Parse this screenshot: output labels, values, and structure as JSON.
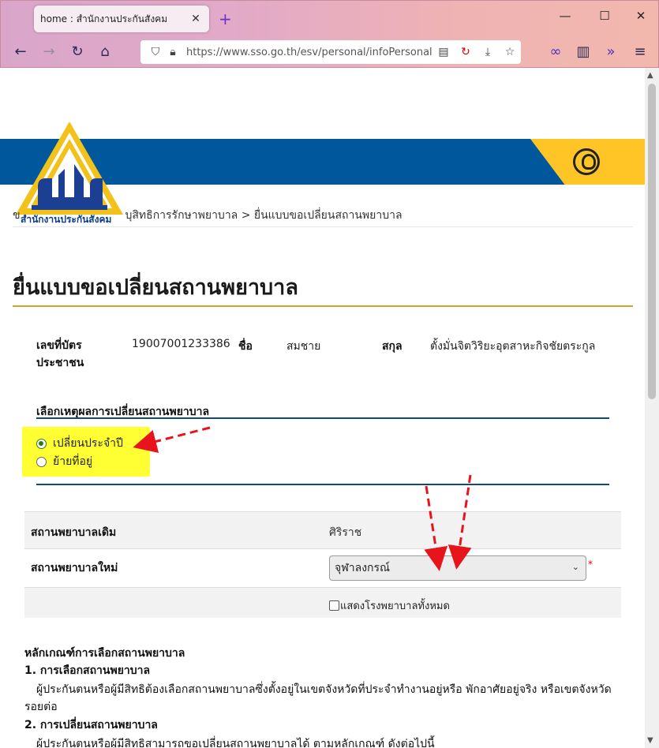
{
  "browser": {
    "tab_title": "home : สำนักงานประกันสังคม",
    "tab_close": "✕",
    "new_tab": "+",
    "url": "https://www.sso.go.th/esv/personal/infoPersonal0",
    "window_controls": [
      "—",
      "☐",
      "✕"
    ]
  },
  "header": {
    "logo_text": "สำนักงานประกันสังคม",
    "brand_blue": "#00579c",
    "brand_yellow": "#ffc425"
  },
  "breadcrumb": {
    "prefix": "ข",
    "text": "บุสิทธิการรักษาพยาบาล > ยื่นแบบขอเปลี่ยนสถานพยาบาล"
  },
  "page": {
    "title": "ยื่นแบบขอเปลี่ยนสถานพยาบาล"
  },
  "person": {
    "id_label_line1": "เลขที่บัตร",
    "id_label_line2": "ประชาชน",
    "id_value": "19007001233386",
    "name_label": "ชื่อ",
    "name_value": "สมชาย",
    "surname_label": "สกุล",
    "surname_value": "ตั้งมั่นจิตวิริยะอุตสาหะกิจชัยตระกูล"
  },
  "reason": {
    "title": "เลือกเหตุผลการเปลี่ยนสถานพยาบาล",
    "options": [
      {
        "label": "เปลี่ยนประจำปี",
        "selected": true
      },
      {
        "label": "ย้ายที่อยู่",
        "selected": false
      }
    ]
  },
  "hospital": {
    "old_label": "สถานพยาบาลเดิม",
    "old_value": "ศิริราช",
    "new_label": "สถานพยาบาลใหม่",
    "new_value": "จุฬาลงกรณ์",
    "required_mark": "*",
    "show_all_label": "แสดงโรงพยาบาลทั้งหมด"
  },
  "criteria": {
    "heading": "หลักเกณฑ์การเลือกสถานพยาบาล",
    "s1_title": "1.  การเลือกสถานพยาบาล",
    "s1_text_line1": "ผู้ประกันตนหรือผู้มีสิทธิต้องเลือกสถานพยาบาลซึ่งตั้งอยู่ในเขตจังหวัดที่ประจำทำงานอยู่หรือ พักอาศัยอยู่จริง หรือเขตจังหวัด",
    "s1_text_line2": "รอยต่อ",
    "s2_title": "2.  การเปลี่ยนสถานพยาบาล",
    "s2_text_line1": "ผู้ประกันตนหรือผู้มีสิทธิสามารถขอเปลี่ยนสถานพยาบาลได้ ตามหลักเกณฑ์ ดังต่อไปนี้"
  }
}
